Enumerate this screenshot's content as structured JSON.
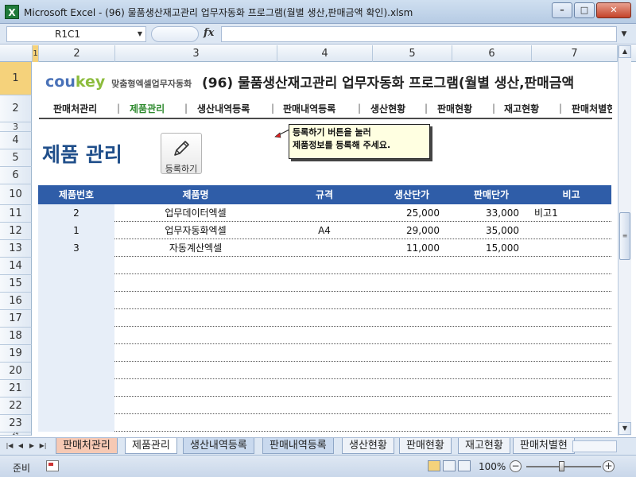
{
  "window": {
    "app_icon": "excel-icon",
    "title": "Microsoft Excel - (96) 물품생산재고관리 업무자동화 프로그램(월별 생산,판매금액 확인).xlsm",
    "buttons": {
      "minimize": "–",
      "maximize": "□",
      "close": "✕"
    }
  },
  "formula_bar": {
    "name_box": "R1C1",
    "fx_label": "fx",
    "formula": ""
  },
  "column_headers": [
    "1",
    "2",
    "3",
    "4",
    "5",
    "6",
    "7"
  ],
  "row_headers": [
    "1",
    "2",
    "3",
    "4",
    "5",
    "6",
    "10",
    "11",
    "12",
    "13",
    "14",
    "15",
    "16",
    "17",
    "18",
    "19",
    "20",
    "21",
    "22",
    "23",
    "24"
  ],
  "banner": {
    "logo_part1": "cou",
    "logo_part2": "key",
    "logo_sub": "맞춤형엑셀업무자동화",
    "title": "(96) 물품생산재고관리 업무자동화 프로그램(월별 생산,판매금액"
  },
  "nav": {
    "items": [
      "판매처관리",
      "제품관리",
      "생산내역등록",
      "판매내역등록",
      "생산현황",
      "판매현황",
      "재고현황",
      "판매처별현"
    ],
    "active_index": 1,
    "separator": "|",
    "active_color": "#2e8a2e"
  },
  "page": {
    "heading": "제품 관리",
    "register_button": "등록하기",
    "callout_line1": "등록하기 버튼을 눌러",
    "callout_line2": "제품정보를 등록해 주세요."
  },
  "table": {
    "header_color": "#2f5da8",
    "columns": [
      "제품번호",
      "제품명",
      "규격",
      "생산단가",
      "판매단가",
      "비고"
    ],
    "rows": [
      {
        "no": "2",
        "name": "업무데이터엑셀",
        "spec": "",
        "cost": "25,000",
        "price": "33,000",
        "note": "비고1"
      },
      {
        "no": "1",
        "name": "업무자동화엑셀",
        "spec": "A4",
        "cost": "29,000",
        "price": "35,000",
        "note": ""
      },
      {
        "no": "3",
        "name": "자동계산엑셀",
        "spec": "",
        "cost": "11,000",
        "price": "15,000",
        "note": ""
      },
      {
        "no": "",
        "name": "",
        "spec": "",
        "cost": "",
        "price": "",
        "note": ""
      },
      {
        "no": "",
        "name": "",
        "spec": "",
        "cost": "",
        "price": "",
        "note": ""
      },
      {
        "no": "",
        "name": "",
        "spec": "",
        "cost": "",
        "price": "",
        "note": ""
      },
      {
        "no": "",
        "name": "",
        "spec": "",
        "cost": "",
        "price": "",
        "note": ""
      },
      {
        "no": "",
        "name": "",
        "spec": "",
        "cost": "",
        "price": "",
        "note": ""
      },
      {
        "no": "",
        "name": "",
        "spec": "",
        "cost": "",
        "price": "",
        "note": ""
      },
      {
        "no": "",
        "name": "",
        "spec": "",
        "cost": "",
        "price": "",
        "note": ""
      },
      {
        "no": "",
        "name": "",
        "spec": "",
        "cost": "",
        "price": "",
        "note": ""
      },
      {
        "no": "",
        "name": "",
        "spec": "",
        "cost": "",
        "price": "",
        "note": ""
      },
      {
        "no": "",
        "name": "",
        "spec": "",
        "cost": "",
        "price": "",
        "note": ""
      }
    ]
  },
  "sheet_tabs": [
    {
      "label": "판매처관리",
      "style": "t-orange"
    },
    {
      "label": "제품관리",
      "style": "t-active"
    },
    {
      "label": "생산내역등록",
      "style": "t-blue"
    },
    {
      "label": "판매내역등록",
      "style": "t-blue"
    },
    {
      "label": "생산현황",
      "style": "t-plain"
    },
    {
      "label": "판매현황",
      "style": "t-plain"
    },
    {
      "label": "재고현황",
      "style": "t-plain"
    },
    {
      "label": "판매처별현",
      "style": "t-plain"
    }
  ],
  "status": {
    "ready": "준비",
    "zoom": "100%",
    "zoom_minus": "−",
    "zoom_plus": "+"
  }
}
